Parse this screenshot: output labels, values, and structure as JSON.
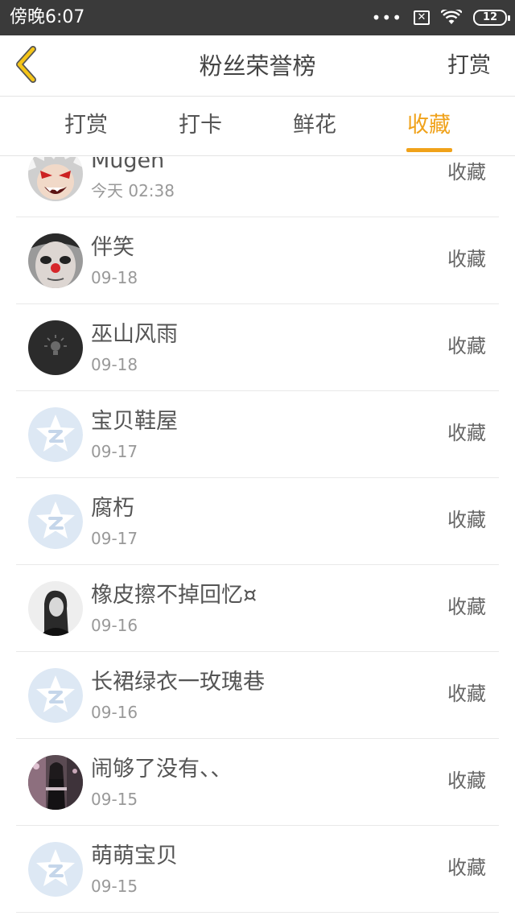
{
  "status_bar": {
    "time": "傍晚6:07",
    "signal_dots": "•••",
    "sim_icon": "sim-x-icon",
    "wifi_icon": "wifi-icon",
    "battery_level": "12"
  },
  "header": {
    "back_icon": "chevron-left-icon",
    "title": "粉丝荣誉榜",
    "action_label": "打赏"
  },
  "tabs": [
    {
      "label": "打赏",
      "active": false
    },
    {
      "label": "打卡",
      "active": false
    },
    {
      "label": "鲜花",
      "active": false
    },
    {
      "label": "收藏",
      "active": true
    }
  ],
  "colors": {
    "accent": "#f0a21a",
    "status_bar": "#3a3a3a",
    "default_avatar": "#dde8f4"
  },
  "fans": [
    {
      "name": "Mugen",
      "date": "今天 02:38",
      "tag": "收藏",
      "avatar": "anime-avatar"
    },
    {
      "name": "伴笑",
      "date": "09-18",
      "tag": "收藏",
      "avatar": "clown-face-avatar"
    },
    {
      "name": "巫山风雨",
      "date": "09-18",
      "tag": "收藏",
      "avatar": "lightbulb-avatar"
    },
    {
      "name": "宝贝鞋屋",
      "date": "09-17",
      "tag": "收藏",
      "avatar": "default-star-avatar"
    },
    {
      "name": "腐朽",
      "date": "09-17",
      "tag": "收藏",
      "avatar": "default-star-avatar"
    },
    {
      "name": "橡皮擦不掉回忆¤",
      "date": "09-16",
      "tag": "收藏",
      "avatar": "sketch-girl-avatar"
    },
    {
      "name": "长裙绿衣一玫瑰巷",
      "date": "09-16",
      "tag": "收藏",
      "avatar": "default-star-avatar"
    },
    {
      "name": "闹够了没有、、",
      "date": "09-15",
      "tag": "收藏",
      "avatar": "photo-girl-avatar"
    },
    {
      "name": "萌萌宝贝",
      "date": "09-15",
      "tag": "收藏",
      "avatar": "default-star-avatar"
    }
  ]
}
